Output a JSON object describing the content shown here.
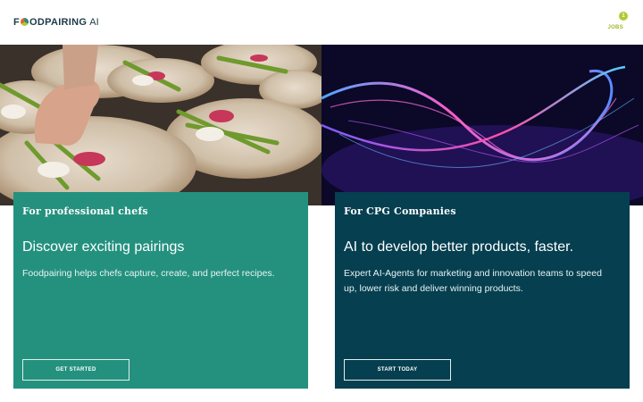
{
  "header": {
    "logo_text": "FOODPAIRING",
    "logo_suffix": "AI",
    "jobs_label": "JOBS",
    "jobs_count": "1",
    "logo_dot_colors": [
      "#1e8f7f",
      "#b4c832",
      "#e2633b"
    ]
  },
  "cards": {
    "chefs": {
      "kicker": "For professional chefs",
      "title": "Discover exciting pairings",
      "body": "Foodpairing helps chefs capture, create, and perfect recipes.",
      "button": "GET STARTED",
      "color": "#24917f"
    },
    "cpg": {
      "kicker": "For CPG Companies",
      "title": "AI to develop better products, faster.",
      "body": "Expert AI-Agents for marketing and innovation teams to speed up, lower risk and deliver winning products.",
      "button": "START TODAY",
      "color": "#053f50"
    }
  },
  "images": {
    "left": "food-plating-photo",
    "right": "abstract-neon-waves-image"
  },
  "colors": {
    "accent": "#b4c832",
    "brand_dark": "#1d3b46"
  }
}
